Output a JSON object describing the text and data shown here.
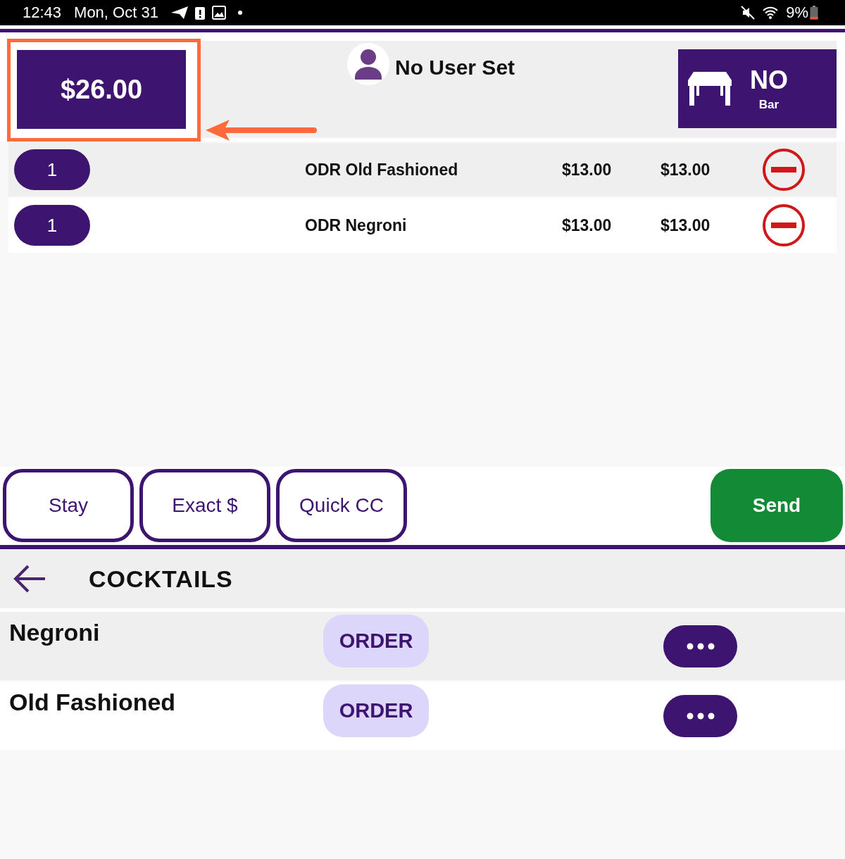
{
  "status_bar": {
    "time": "12:43",
    "date": "Mon, Oct 31",
    "battery": "9%"
  },
  "header": {
    "total": "$26.00",
    "highlighted": true,
    "user": "No User Set",
    "table": {
      "name": "NO",
      "area": "Bar"
    }
  },
  "order_items": [
    {
      "quantity": "1",
      "name": "ODR Old Fashioned",
      "price": "$13.00",
      "total": "$13.00"
    },
    {
      "quantity": "1",
      "name": "ODR Negroni",
      "price": "$13.00",
      "total": "$13.00"
    }
  ],
  "actions": [
    {
      "label": "Stay",
      "kind": "outline"
    },
    {
      "label": "Exact $",
      "kind": "outline"
    },
    {
      "label": "Quick CC",
      "kind": "outline"
    },
    {
      "label": "Send",
      "kind": "primary"
    }
  ],
  "category": {
    "title": "COCKTAILS"
  },
  "menu_items": [
    {
      "name": "Negroni",
      "order_label": "ORDER"
    },
    {
      "name": "Old Fashioned",
      "order_label": "ORDER"
    }
  ]
}
